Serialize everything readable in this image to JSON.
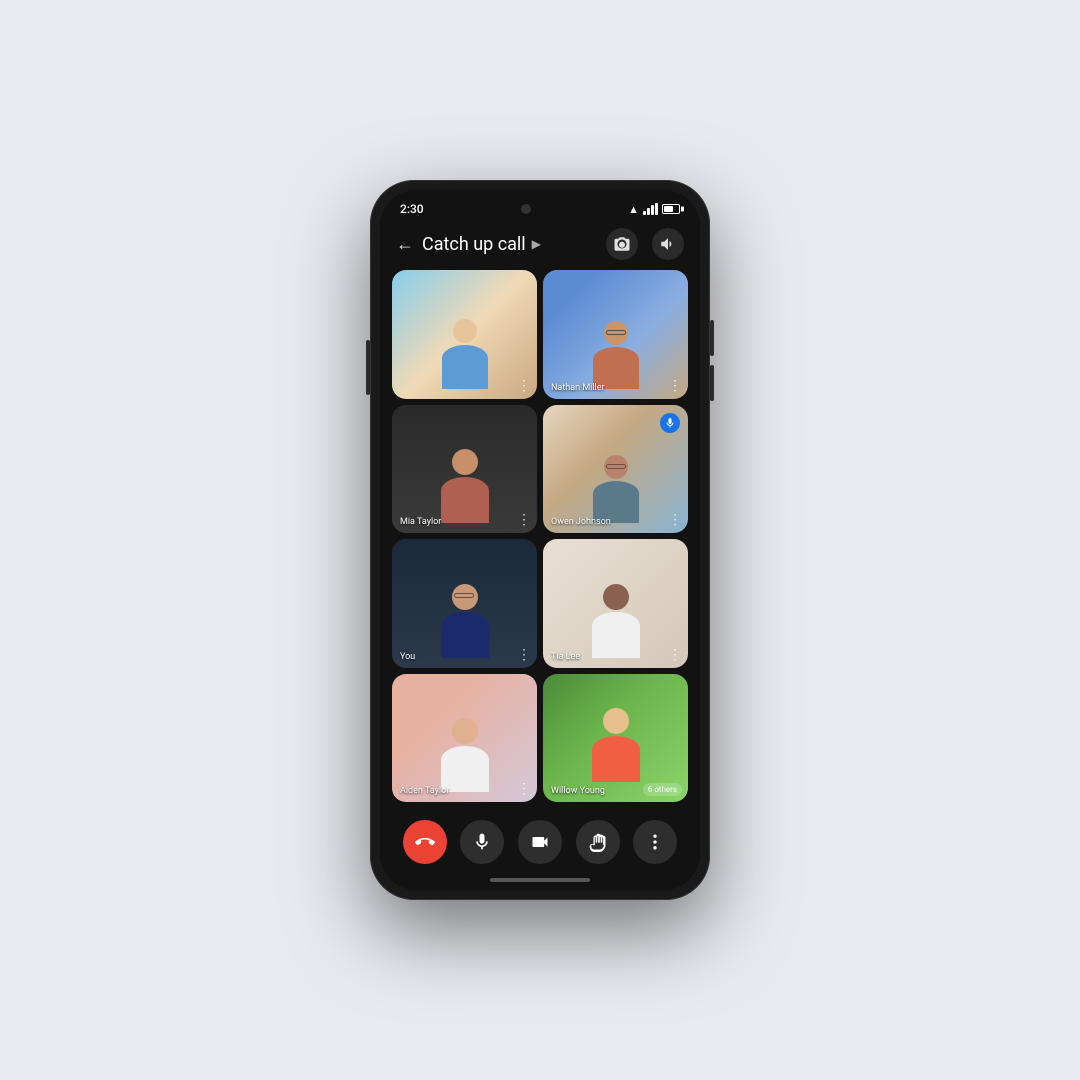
{
  "device": {
    "time": "2:30",
    "battery_level": "65%"
  },
  "call": {
    "title": "Catch up call",
    "back_label": "←",
    "chevron": "▶"
  },
  "participants": [
    {
      "id": 1,
      "name": "",
      "muted": false,
      "speaking": false
    },
    {
      "id": 2,
      "name": "Nathan Miller",
      "muted": false,
      "speaking": false
    },
    {
      "id": 3,
      "name": "Mia Taylor",
      "muted": false,
      "speaking": false
    },
    {
      "id": 4,
      "name": "Owen Johnson",
      "muted": false,
      "speaking": true
    },
    {
      "id": 5,
      "name": "You",
      "muted": false,
      "speaking": false
    },
    {
      "id": 6,
      "name": "Tia Lee",
      "muted": false,
      "speaking": false
    },
    {
      "id": 7,
      "name": "Aiden Taylor",
      "muted": false,
      "speaking": false
    },
    {
      "id": 8,
      "name": "Willow Young",
      "muted": false,
      "speaking": false,
      "others_count": "6 others"
    }
  ],
  "controls": {
    "end_call_label": "end call",
    "mute_label": "mute",
    "camera_label": "camera",
    "hand_label": "raise hand",
    "more_label": "more options"
  }
}
